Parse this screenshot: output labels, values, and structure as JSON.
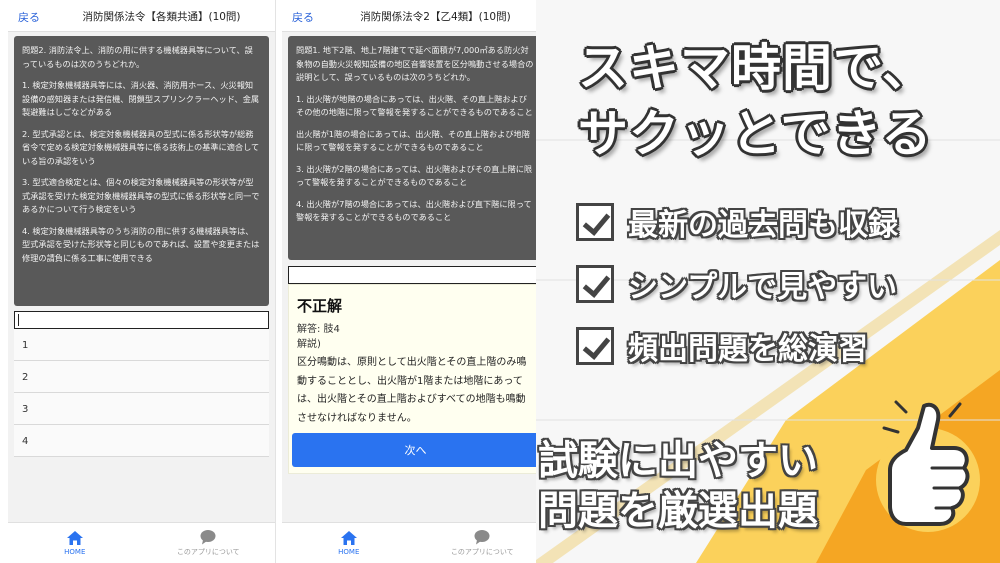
{
  "phone1": {
    "header": {
      "back": "戻る",
      "title": "消防関係法令【各類共通】(10問)"
    },
    "question": {
      "stem": "問題2. 消防法令上、消防の用に供する機械器具等について、誤っているものは次のうちどれか。",
      "options": [
        "1. 検定対象機械器具等には、消火器、消防用ホース、火災報知設備の感知器または発信機、閉鎖型スプリンクラーヘッド、金属製避難はしごなどがある",
        "2. 型式承認とは、検定対象機械器具の型式に係る形状等が総務省令で定める検定対象機械器具等に係る技術上の基準に適合している旨の承認をいう",
        "3. 型式適合検定とは、個々の検定対象機械器具等の形状等が型式承認を受けた検定対象機械器具等の型式に係る形状等と同一であるかについて行う検定をいう",
        "4. 検定対象機械器具等のうち消防の用に供する機械器具等は、型式承認を受けた形状等と同じものであれば、設置や変更または修理の請負に係る工事に使用できる"
      ]
    },
    "choices": [
      "1",
      "2",
      "3",
      "4"
    ]
  },
  "phone2": {
    "header": {
      "back": "戻る",
      "title": "消防関係法令2【乙4類】(10問)"
    },
    "question": {
      "stem": "問題1. 地下2階、地上7階建てで延べ面積が7,000㎡ある防火対象物の自動火災報知設備の地区音響装置を区分鳴動させる場合の説明として、誤っているものは次のうちどれか。",
      "options": [
        "1. 出火階が地階の場合にあっては、出火階、その直上階およびその他の地階に限って警報を発することができるものであること",
        "出火階が1階の場合にあっては、出火階、その直上階および地階に限って警報を発することができるものであること",
        "3. 出火階が2階の場合にあっては、出火階およびその直上階に限って警報を発することができるものであること",
        "4. 出火階が7階の場合にあっては、出火階および直下階に限って警報を発することができるものであること"
      ]
    },
    "result": {
      "title": "不正解",
      "answer": "解答: 肢4",
      "explanation_label": "解説)",
      "explanation": "区分鳴動は、原則として出火階とその直上階のみ鳴動することとし、出火階が1階または地階にあっては、出火階とその直上階およびすべての地階も鳴動させなければなりません。",
      "next": "次へ"
    }
  },
  "tabbar": {
    "home": "HOME",
    "about": "このアプリについて"
  },
  "promo": {
    "headline_1": "スキマ時間で、",
    "headline_2": "サクッとできる",
    "features": [
      "最新の過去問も収録",
      "シンプルで見やすい",
      "頻出問題を総演習"
    ],
    "bottom_1": "試験に出やすい",
    "bottom_2": "問題を厳選出題"
  },
  "colors": {
    "accent": "#2a73f0",
    "question_bg": "#595959",
    "result_bg": "#fffff0",
    "promo_orange": "#f5a623",
    "promo_yellow": "#fbd15b"
  },
  "icons": [
    "home-icon",
    "chat-bubble-icon",
    "check-box-icon",
    "thumbs-up-hand-icon"
  ]
}
